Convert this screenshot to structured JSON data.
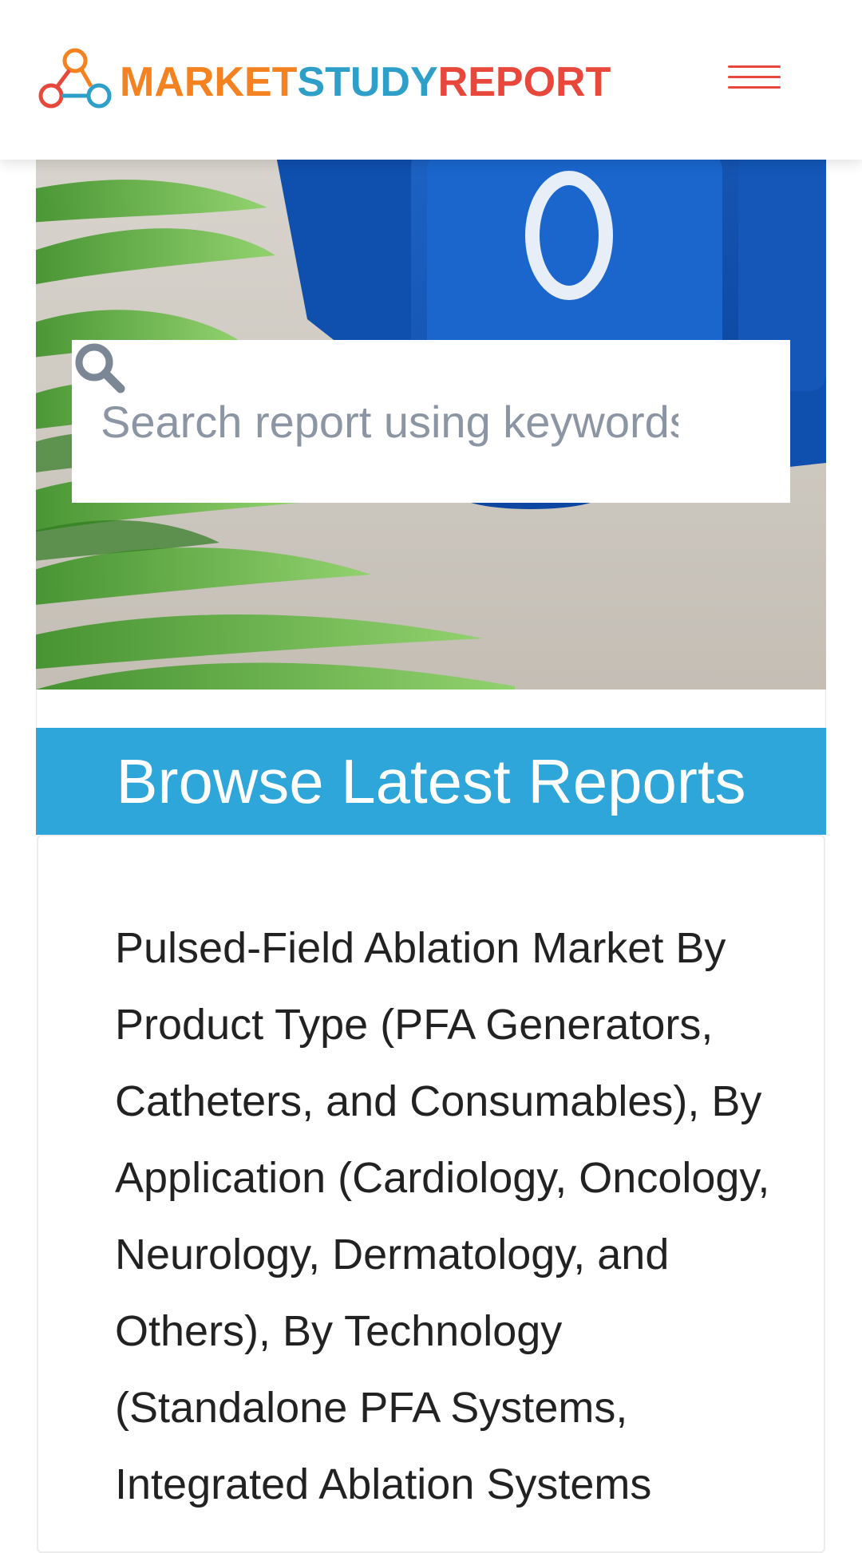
{
  "header": {
    "logo": {
      "part1": "MARKET",
      "part2": "STUDY",
      "part3": "REPORT",
      "colors": {
        "part1": "#F58220",
        "part2": "#2E9FC9",
        "part3": "#E8483C"
      }
    },
    "menu_icon": "hamburger-menu-icon",
    "menu_color": "#E8483C"
  },
  "hero": {
    "search": {
      "placeholder": "Search report using keywords",
      "value": "",
      "icon": "search-icon"
    }
  },
  "browse": {
    "title": "Browse Latest Reports",
    "bar_color": "#2EA6D9",
    "reports": [
      {
        "title": "Pulsed-Field Ablation Market By Product Type (PFA Generators, Catheters, and Consumables), By Application (Cardiology, Oncology, Neurology, Dermatology, and Others), By Technology (Standalone PFA Systems, Integrated Ablation Systems"
      }
    ]
  }
}
